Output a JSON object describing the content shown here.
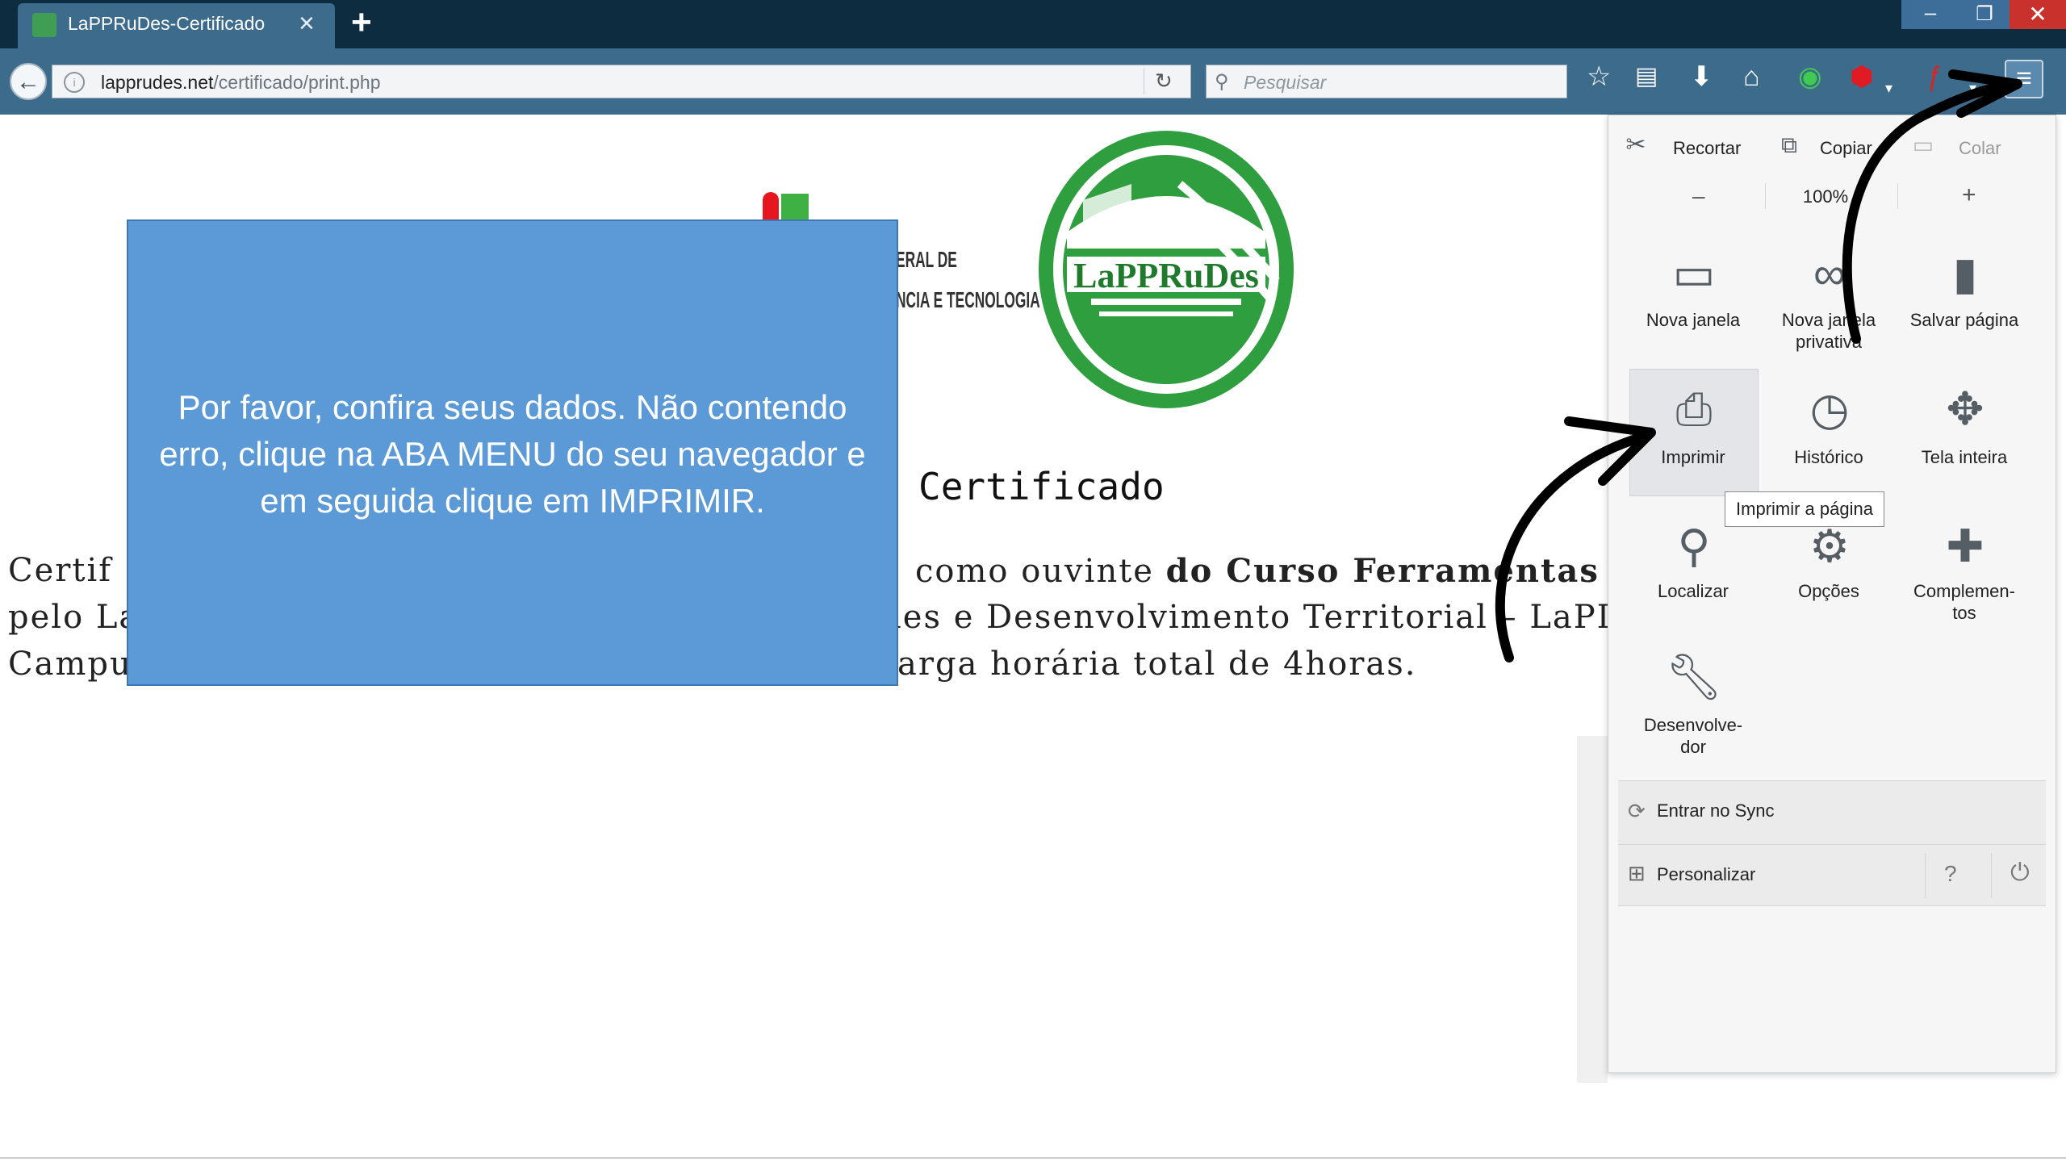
{
  "browser": {
    "tab": {
      "title": "LaPPRuDes-Certificado"
    },
    "new_tab_label": "+",
    "url": {
      "host": "lapprudes.net",
      "path": "/certificado/print.php"
    },
    "search_placeholder": "Pesquisar"
  },
  "page": {
    "institution_lines": [
      "ERAL DE",
      "NCIA E TECNOLOGIA"
    ],
    "logo_text": "LaPPRuDes",
    "cert_title": "Certificado",
    "body_lines": [
      {
        "left": "Certif",
        "right_normal": "como ouvinte ",
        "right_bold": "do Curso Ferramentas de"
      },
      {
        "left": "pelo La",
        "right_normal": "les e Desenvolvimento Territorial – LaPI",
        "right_bold": ""
      },
      {
        "left": "Campus",
        "right_normal": "arga horária total de 4horas.",
        "right_bold": ""
      }
    ]
  },
  "overlay": {
    "message": "Por favor, confira seus dados. Não contendo erro, clique na ABA MENU do seu navegador e em seguida clique em IMPRIMIR."
  },
  "menu": {
    "edit": {
      "cut": "Recortar",
      "copy": "Copiar",
      "paste": "Colar"
    },
    "zoom": {
      "minus": "–",
      "level": "100%",
      "plus": "+"
    },
    "items": [
      {
        "label": "Nova janela",
        "icon": "window-icon"
      },
      {
        "label": "Nova janela privativa",
        "icon": "mask-icon"
      },
      {
        "label": "Salvar página",
        "icon": "page-icon"
      },
      {
        "label": "Imprimir",
        "icon": "printer-icon"
      },
      {
        "label": "Histórico",
        "icon": "clock-icon"
      },
      {
        "label": "Tela inteira",
        "icon": "fullscreen-icon"
      },
      {
        "label": "Localizar",
        "icon": "magnifier-icon"
      },
      {
        "label": "Opções",
        "icon": "gear-icon"
      },
      {
        "label": "Complemen-tos",
        "icon": "puzzle-icon"
      },
      {
        "label": "Desenvolve-dor",
        "icon": "wrench-icon"
      }
    ],
    "tooltip": "Imprimir a página",
    "sync": "Entrar no Sync",
    "customize": "Personalizar"
  },
  "colors": {
    "titlebar": "#0e2c3f",
    "toolbar": "#3d6b8c",
    "overlay": "#5b9ad6",
    "logo_green": "#2e9e3f"
  }
}
